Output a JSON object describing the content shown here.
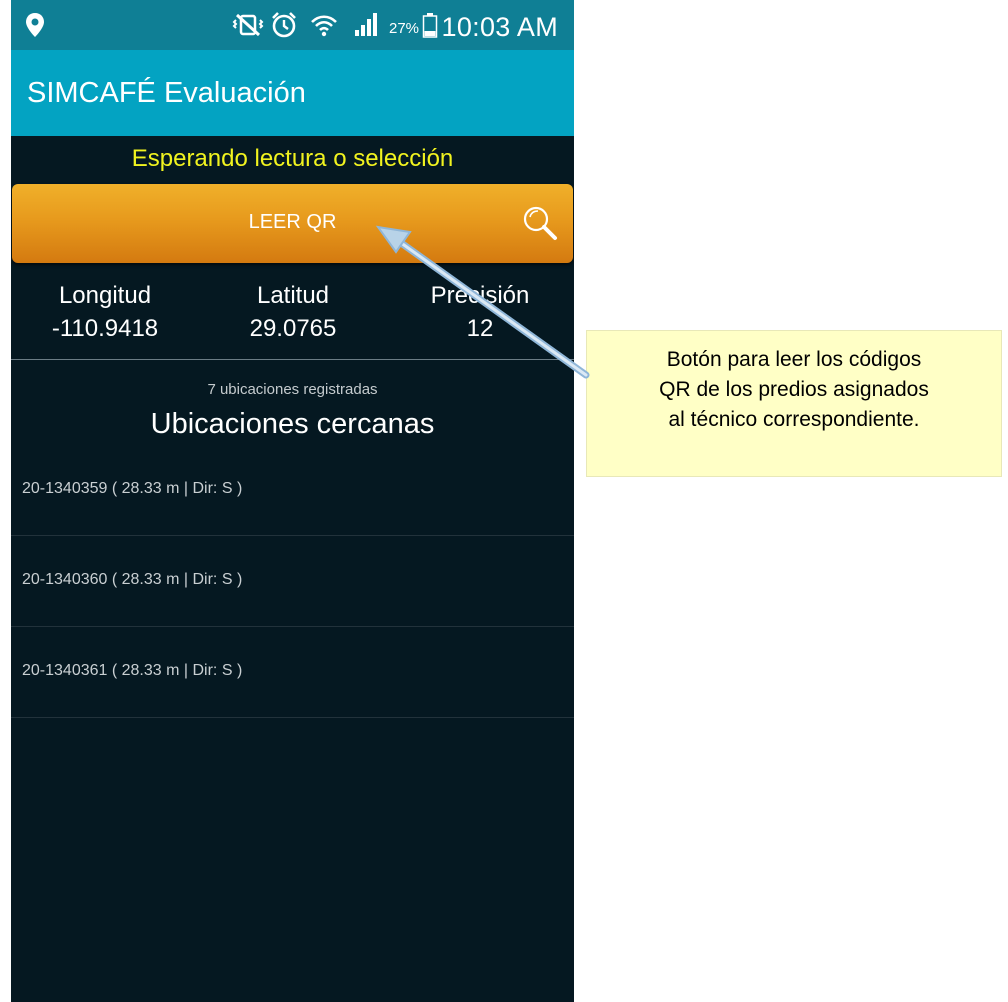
{
  "status_bar": {
    "battery_percent": "27%",
    "time": "10:03 AM",
    "icons": [
      "location-pin-icon",
      "mute-vibrate-icon",
      "alarm-icon",
      "wifi-icon",
      "signal-icon",
      "battery-icon"
    ]
  },
  "app": {
    "title": "SIMCAFÉ Evaluación"
  },
  "status_message": "Esperando lectura o selección",
  "qr_button": {
    "label": "LEER QR",
    "icon": "search-icon"
  },
  "coordinates": {
    "longitude_label": "Longitud",
    "longitude_value": "-110.9418",
    "latitude_label": "Latitud",
    "latitude_value": "29.0765",
    "precision_label": "Precisión",
    "precision_value": "12"
  },
  "nearby": {
    "count_text": "7 ubicaciones registradas",
    "title": "Ubicaciones cercanas",
    "items": [
      "20-1340359 ( 28.33 m | Dir: S )",
      "20-1340360 ( 28.33 m | Dir: S )",
      "20-1340361 ( 28.33 m | Dir: S )"
    ]
  },
  "callout": {
    "lines": [
      "Botón para leer los códigos",
      "QR de los predios asignados",
      "al técnico correspondiente."
    ]
  },
  "colors": {
    "status_bar": "#0f7f95",
    "app_bar": "#03a3c2",
    "background": "#051821",
    "status_message": "#f1f31f",
    "button_orange": "#e79a1d",
    "callout_bg": "#ffffc6",
    "arrow": "#b8d3e8"
  }
}
